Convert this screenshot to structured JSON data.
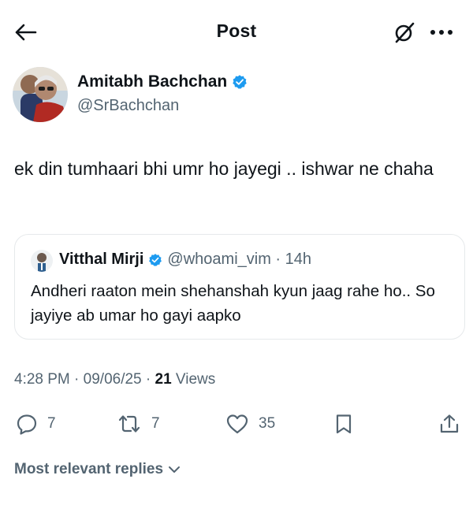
{
  "header": {
    "title": "Post",
    "back_icon": "arrow-left-icon",
    "grok_icon": "grok-icon",
    "more_icon": "more-horizontal-icon"
  },
  "tweet": {
    "author": {
      "display_name": "Amitabh Bachchan",
      "handle": "@SrBachchan",
      "verified": true,
      "verified_color": "#1d9bf0"
    },
    "text": "ek din tumhaari bhi umr ho jayegi .. ishwar ne chaha",
    "quote": {
      "display_name": "Vitthal Mirji",
      "handle": "@whoami_vim",
      "separator": " · ",
      "time": "14h",
      "verified": true,
      "text": "Andheri raaton mein shehanshah kyun jaag rahe ho.. So jayiye ab umar ho gayi aapko"
    },
    "meta": {
      "time": "4:28 PM",
      "dot": " · ",
      "date": "09/06/25",
      "views_count": "21",
      "views_label": " Views"
    },
    "actions": {
      "replies": "7",
      "reposts": "7",
      "likes": "35"
    }
  },
  "replies_filter": {
    "label": "Most relevant replies"
  },
  "colors": {
    "text_primary": "#0f1419",
    "text_secondary": "#536471",
    "accent": "#1d9bf0",
    "border": "#e6e9eb"
  }
}
